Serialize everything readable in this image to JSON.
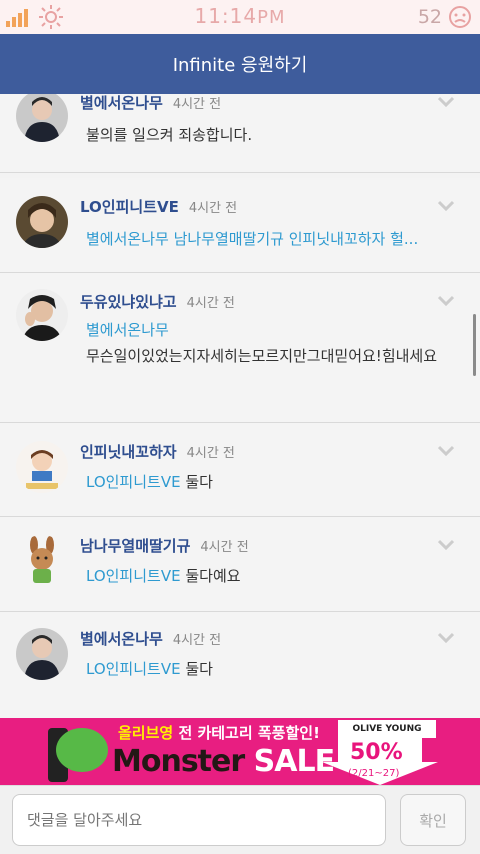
{
  "status_bar": {
    "time": "11:14",
    "ampm": "PM",
    "battery": "52"
  },
  "header": {
    "title": "Infinite 응원하기"
  },
  "comments": [
    {
      "author": "별에서온나무",
      "time": "4시간 전",
      "mention": "",
      "text": "불의를 일으켜 죄송합니다.",
      "avatar": "boy-black-coat"
    },
    {
      "author": "LO인피니트VE",
      "time": "4시간 전",
      "mention": "",
      "text": "별에서온나무 남나무열매딸기규 인피닛내꼬하자 헐...",
      "avatar": "boy-portrait"
    },
    {
      "author": "두유있냐있냐고",
      "time": "4시간 전",
      "mention": "별에서온나무",
      "text": "무슨일이있었는지자세히는모르지만그대믿어요!힘내세요",
      "avatar": "boy-hand-face"
    },
    {
      "author": "인피닛내꼬하자",
      "time": "4시간 전",
      "mention": "LO인피니트VE",
      "text": "둘다",
      "avatar": "cartoon-chibi"
    },
    {
      "author": "남나무열매딸기규",
      "time": "4시간 전",
      "mention": "LO인피니트VE",
      "text": "둘다예요",
      "avatar": "cartoon-bunny"
    },
    {
      "author": "별에서온나무",
      "time": "4시간 전",
      "mention": "LO인피니트VE",
      "text": "둘다",
      "avatar": "boy-black-coat"
    }
  ],
  "banner": {
    "brand": "올리브영",
    "headline": "전 카테고리 폭풍할인!",
    "sale_word1": "Monster",
    "sale_word2": "SALE",
    "logo": "OLIVE YOUNG",
    "percent": "50%",
    "dates": "(2/21~27)"
  },
  "comment_bar": {
    "placeholder": "댓글을 달아주세요",
    "submit_label": "확인"
  },
  "colors": {
    "header": "#3e5c9c",
    "author": "#2f4e8f",
    "mention": "#2e9ad0",
    "banner": "#e81e81"
  },
  "icons": [
    "signal-bars-icon",
    "sun-icon",
    "battery-face-icon",
    "chevron-down-icon"
  ]
}
